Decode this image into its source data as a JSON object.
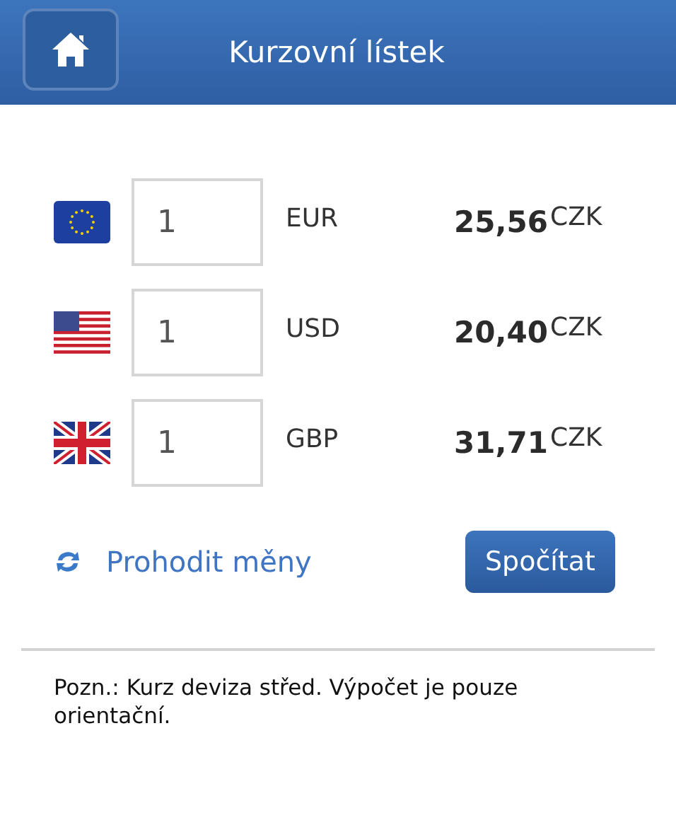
{
  "header": {
    "title": "Kurzovní lístek"
  },
  "rates": [
    {
      "kind": "eu",
      "amount": "1",
      "currency": "EUR",
      "result": "25,56",
      "target": "CZK"
    },
    {
      "kind": "us",
      "amount": "1",
      "currency": "USD",
      "result": "20,40",
      "target": "CZK"
    },
    {
      "kind": "gb",
      "amount": "1",
      "currency": "GBP",
      "result": "31,71",
      "target": "CZK"
    }
  ],
  "swap_link": "Prohodit měny",
  "calculate_button": "Spočítat",
  "note": "Pozn.: Kurz deviza střed. Výpočet je pouze orientační."
}
